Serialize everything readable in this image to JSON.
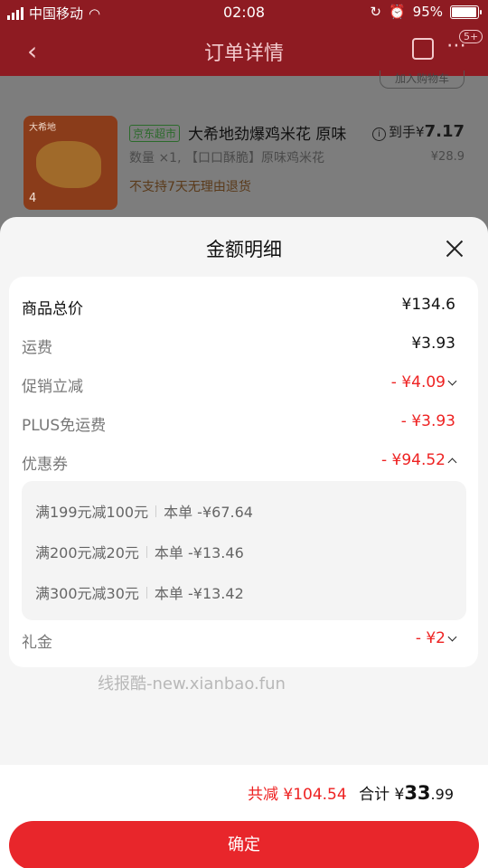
{
  "status_bar": {
    "carrier": "中国移动",
    "time": "02:08",
    "battery_percent": "95%",
    "battery_level": 0.95
  },
  "header": {
    "title": "订单详情",
    "back_icon": "chevron-left-icon",
    "message_badge": "5+"
  },
  "background": {
    "button_partial": "加入购物车",
    "product": {
      "store_tag": "京东超市",
      "name": "大希地劲爆鸡米花 原味",
      "spec": "数量 ×1, 【口口酥脆】原味鸡米花",
      "no_return": "不支持7天无理由退货",
      "final_label": "到手",
      "final_currency": "¥",
      "final_price": "7.17",
      "orig_price": "¥28.9",
      "thumb_brand": "大希地",
      "thumb_tag": "4"
    }
  },
  "sheet": {
    "title": "金额明细",
    "rows": [
      {
        "label": "商品总价",
        "value": "¥134.6"
      },
      {
        "label": "运费",
        "value": "¥3.93"
      },
      {
        "label": "促销立减",
        "value": "- ¥4.09"
      },
      {
        "label": "PLUS免运费",
        "value": "- ¥3.93"
      },
      {
        "label": "优惠券",
        "value": "- ¥94.52"
      },
      {
        "label": "礼金",
        "value": "- ¥2"
      }
    ],
    "coupons": [
      {
        "name": "满199元减100元",
        "detail": "本单 -¥67.64"
      },
      {
        "name": "满200元减20元",
        "detail": "本单 -¥13.46"
      },
      {
        "name": "满300元减30元",
        "detail": "本单 -¥13.42"
      }
    ],
    "watermark": "线报酷-new.xianbao.fun"
  },
  "footer": {
    "reduce_text": "共减 ¥104.54",
    "total_label": "合计",
    "total_currency": "¥",
    "total_int": "33",
    "total_dec": ".99",
    "confirm_label": "确定"
  },
  "colors": {
    "accent": "#e8262b",
    "discount": "#ee2222"
  }
}
